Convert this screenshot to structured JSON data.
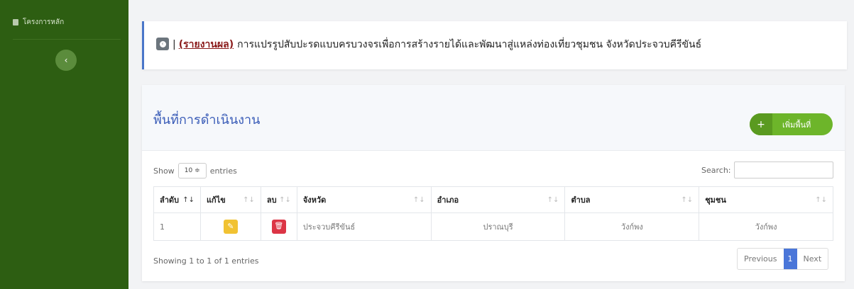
{
  "sidebar": {
    "menu_item": "โครงการหลัก",
    "collapse_glyph": "‹"
  },
  "banner": {
    "back_glyph": "‹",
    "separator": "|",
    "link": "(รายงานผล)",
    "title": "การแปรรูปสับปะรดแบบครบวงจรเพื่อการสร้างรายได้และพัฒนาสู่แหล่งท่องเที่ยวชุมชน จังหวัดประจวบคีรีขันธ์"
  },
  "card": {
    "title": "พื้นที่การดำเนินงาน",
    "add_button": "เพิ่มพื้นที่",
    "add_icon": "+"
  },
  "table_controls": {
    "show_label": "Show",
    "page_length": "10 ≑",
    "entries_label": "entries",
    "search_label": "Search:"
  },
  "table": {
    "headers": [
      "ลำดับ",
      "แก้ไข",
      "ลบ",
      "จังหวัด",
      "อำเภอ",
      "ตำบล",
      "ชุมชน"
    ],
    "rows": [
      {
        "index": "1",
        "edit_icon": "✎",
        "delete_icon": "🗑",
        "province": "ประจวบคีรีขันธ์",
        "district": "ปราณบุรี",
        "subdistrict": "วังก์พง",
        "community": "วังก์พง"
      }
    ]
  },
  "footer": {
    "info": "Showing 1 to 1 of 1 entries",
    "previous": "Previous",
    "current_page": "1",
    "next": "Next"
  },
  "colors": {
    "sidebar": "#2d5e12",
    "accent": "#4a76c9",
    "add_button": "#6db52a",
    "edit": "#f1c232",
    "delete": "#dc3545"
  }
}
